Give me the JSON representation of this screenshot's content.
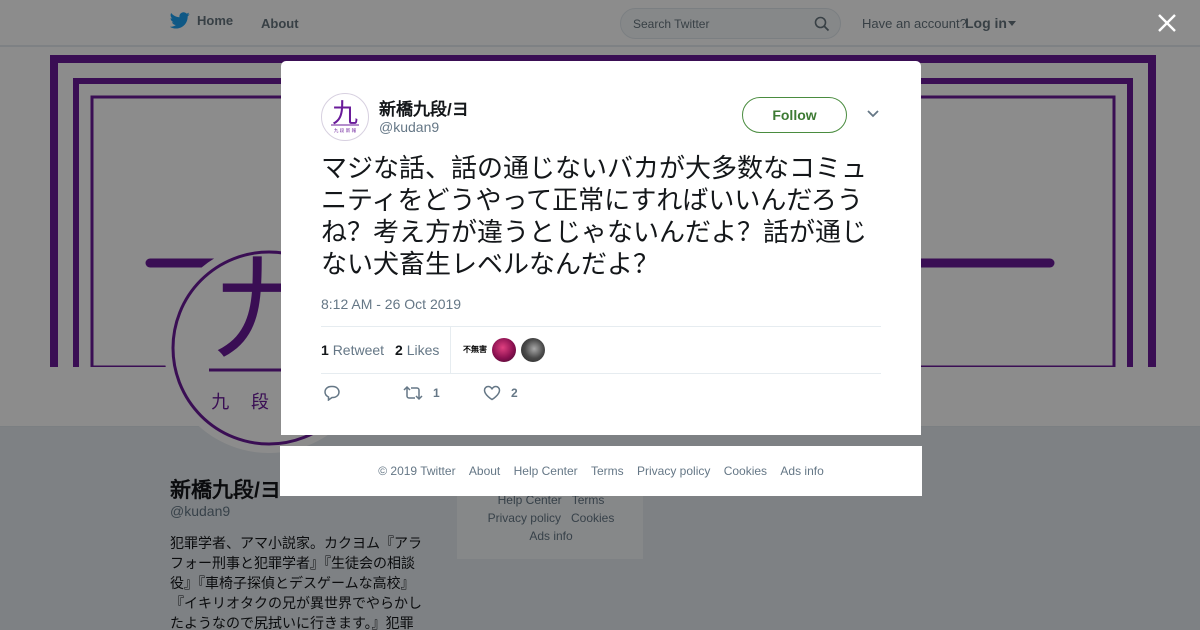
{
  "nav": {
    "home_label": "Home",
    "about_label": "About",
    "search_placeholder": "Search Twitter",
    "account_prompt": "Have an account?",
    "login_label": "Log in"
  },
  "profile": {
    "name": "新橋九段/ヨ",
    "handle": "@kudan9",
    "avatar_char": "九",
    "avatar_sub": "九 段 新 報",
    "big_avatar_sub": "九 段 新",
    "bio": "犯罪学者、アマ小説家。カクヨム『アラフォー刑事と犯罪学者』『生徒会の相談役』『車椅子探偵とデスゲームな高校』『イキリオタクの兄が異世界でやらかしたようなので尻拭いに行きます。』犯罪"
  },
  "bg_footer": {
    "row1": [
      "Help Center",
      "Terms"
    ],
    "row2": [
      "Privacy policy",
      "Cookies"
    ],
    "row3": [
      "Ads info"
    ]
  },
  "tweet": {
    "name": "新橋九段/ヨ",
    "handle": "@kudan9",
    "follow_label": "Follow",
    "text": "マジな話、話の通じないバカが大多数なコミュニティをどうやって正常にすればいいんだろうね？考え方が違うとじゃないんだよ？話が通じない犬畜生レベルなんだよ？",
    "timestamp": "8:12 AM - 26 Oct 2019",
    "retweet_count": "1",
    "retweet_label": "Retweet",
    "likes_count": "2",
    "likes_label": "Likes",
    "liker1_text": "不無害",
    "action_retweet_count": "1",
    "action_like_count": "2"
  },
  "footer": {
    "links": [
      "© 2019 Twitter",
      "About",
      "Help Center",
      "Terms",
      "Privacy policy",
      "Cookies",
      "Ads info"
    ]
  },
  "colors": {
    "brand_purple": "#6a1b9a",
    "twitter_blue": "#1da1f2",
    "follow_green": "#3d7a33"
  }
}
